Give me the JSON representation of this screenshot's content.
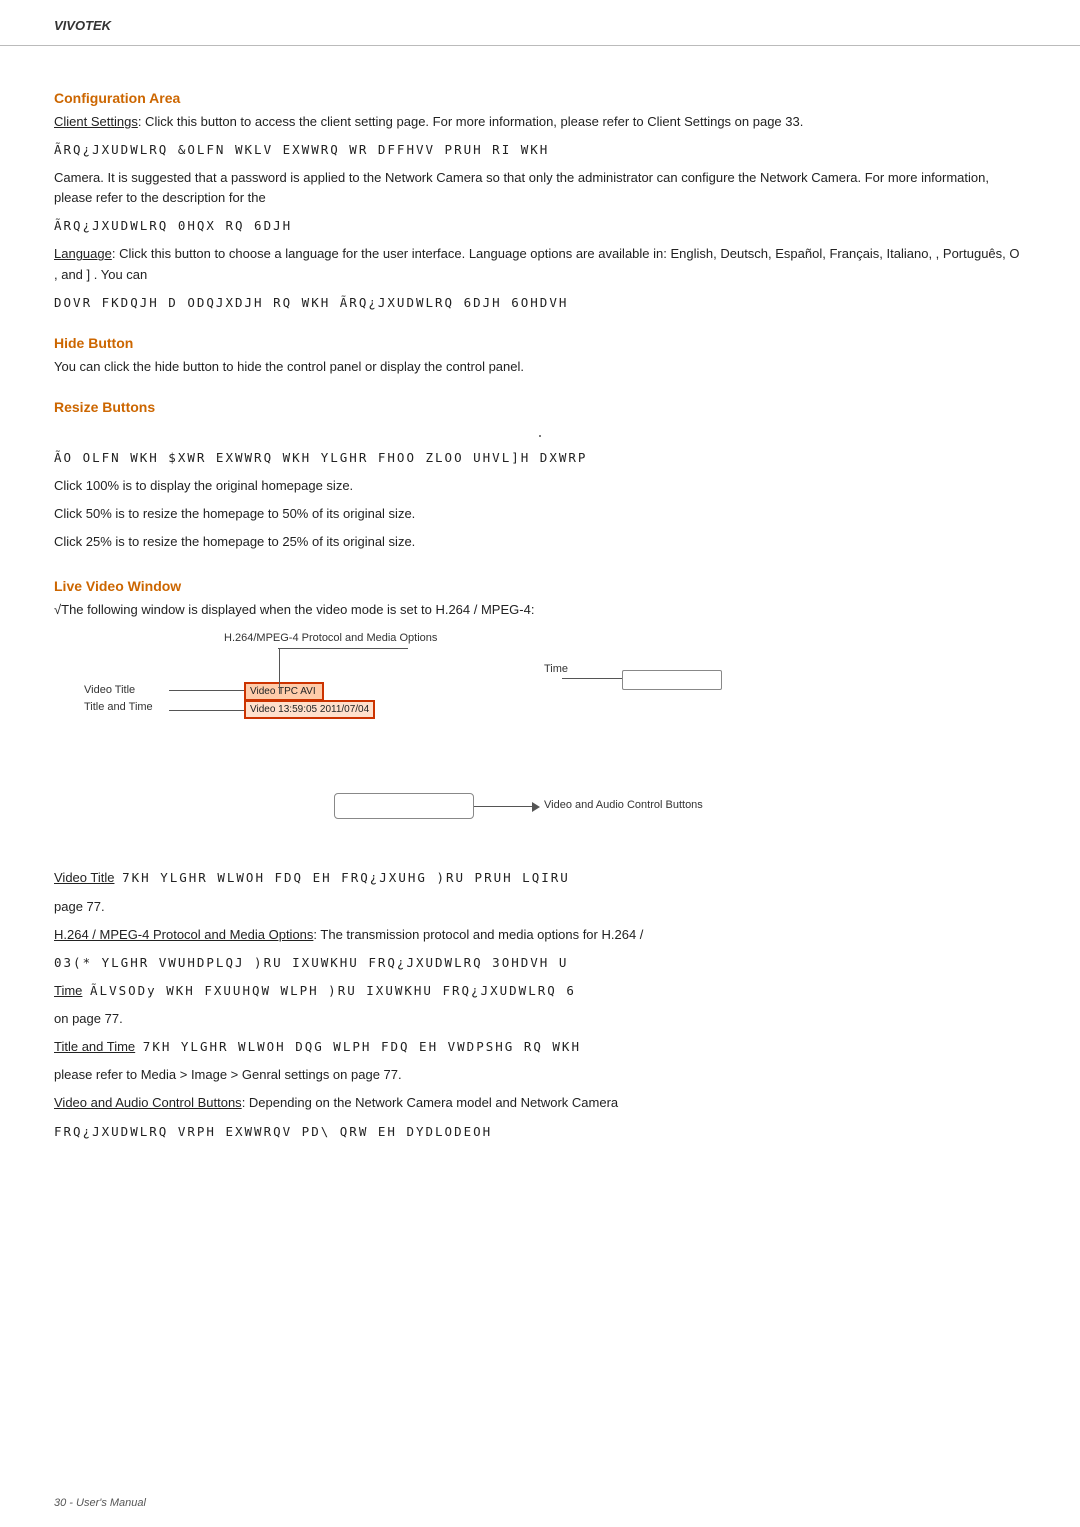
{
  "header": {
    "brand": "VIVOTEK"
  },
  "footer": {
    "page_label": "30 - User's Manual"
  },
  "sections": {
    "configuration_area": {
      "heading": "Configuration Area",
      "client_settings_label": "Client Settings",
      "client_settings_text": ": Click this button to access the client setting page. For more information, please refer to Client Settings on page 33.",
      "config_encoded_line1": "ÃRQ¿JXUDWLRQ   &OLFN  WKLV  EXWWRQ  WR  DFFHVV  PRUH  RI  WKH",
      "config_text2": "Camera. It is suggested that a password is applied to the Network Camera so that only the administrator can configure the Network Camera. For more information, please refer to the description for the",
      "config_encoded_line2": "ÃRQ¿JXUDWLRQ  0HQX  RQ  6DJH",
      "language_label": "Language",
      "language_text": ": Click this button to choose a language for the user interface. Language options are available in: English, Deutsch, Español, Français, Italiano,       , Português, O      , and  ]       . You can",
      "language_encoded": "DOVR FKDQJH D ODQJXDJH RQ WKH ÃRQ¿JXUDWLRQ 6DJH 6OHDVH"
    },
    "hide_button": {
      "heading": "Hide Button",
      "text": "You can click the hide button to hide the control panel or display the control panel."
    },
    "resize_buttons": {
      "heading": "Resize Buttons",
      "dot": ".",
      "encoded_line": "ÃO OLFN  WKH  $XWR  EXWWRQ   WKH  YLGHR  FHOO  ZLOO  UHVL]H  DXWRP",
      "line100": "Click 100% is to display the original homepage size.",
      "line50": "Click 50% is to resize the homepage to 50% of its original size.",
      "line25": "Click 25% is to resize the homepage to 25% of its original size."
    },
    "live_video_window": {
      "heading": "Live Video Window",
      "intro": "√The following window is displayed when the video mode is set to H.264 / MPEG-4:",
      "diagram": {
        "protocol_label": "H.264/MPEG-4 Protocol and Media Options",
        "time_label": "Time",
        "video_title_label": "Video Title",
        "title_and_time_label": "Title and Time",
        "video_title_box1": "Video TPC AVI",
        "video_title_box2": "Video 13:59:05  2011/07/04",
        "control_buttons_label": "Video and Audio Control Buttons"
      },
      "video_title_label": "Video Title",
      "video_title_text": "7KH  YLGHR  WLWOH  FDQ  EH  FRQ¿JXUHG  )RU  PRUH  LQIRU",
      "video_title_text2": "page 77.",
      "h264_label": "H.264 / MPEG-4 Protocol and Media Options",
      "h264_text": ": The transmission protocol and media options for H.264 /",
      "h264_encoded": "03(*   YLGHR  VWUHDPLQJ  )RU  IXUWKHU  FRQ¿JXUDWLRQ  3OHDVH U",
      "time_label": "Time",
      "time_text": "ÃLVSODy  WKH  FXUUHQW  WLPH  )RU  IXUWKHU  FRQ¿JXUDWLRQ  6",
      "time_text2": "on page 77.",
      "title_and_time_label": "Title and Time",
      "title_and_time_text": "7KH  YLGHR  WLWOH  DQG  WLPH  FDQ  EH  VWDPSHG  RQ  WKH",
      "title_and_time_text2": "please refer to Media > Image > Genral settings on page 77.",
      "video_audio_label": "Video and Audio Control Buttons",
      "video_audio_text": ": Depending on the Network Camera model and Network Camera",
      "video_audio_encoded": "FRQ¿JXUDWLRQ   VRPH  EXWWRQV  PD\\ QRW  EH  DYDLODEOH"
    }
  }
}
